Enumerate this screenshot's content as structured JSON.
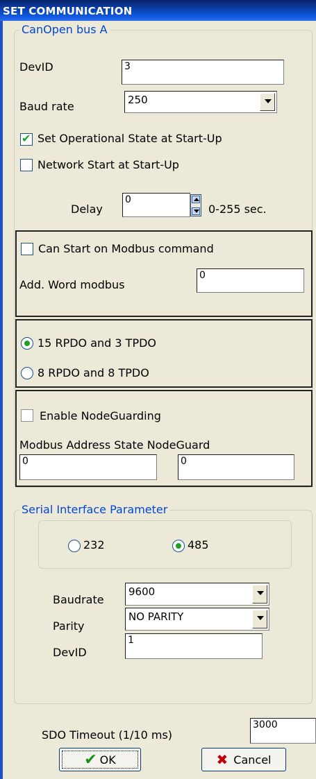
{
  "window": {
    "title": "SET COMMUNICATION"
  },
  "canopen": {
    "legend": "CanOpen bus  A",
    "devid_label": "DevID",
    "devid_value": "3",
    "baud_label": "Baud rate",
    "baud_value": "250",
    "set_operational_label": "Set Operational State at Start-Up",
    "set_operational_checked": true,
    "network_start_label": "Network Start at Start-Up",
    "network_start_checked": false,
    "delay_label": "Delay",
    "delay_value": "0",
    "delay_range": "0-255 sec.",
    "can_start_label": "Can Start on Modbus command",
    "can_start_checked": false,
    "add_word_label": "Add. Word modbus",
    "add_word_value": "0",
    "pdo_option1": "15 RPDO and 3 TPDO",
    "pdo_option2": "8 RPDO and 8 TPDO",
    "pdo_selected": "15 RPDO and 3 TPDO",
    "enable_nodeguard_label": "Enable NodeGuarding",
    "enable_nodeguard_checked": false,
    "modbus_address_state_label": "Modbus Address State NodeGuard",
    "nodeguard_value1": "0",
    "nodeguard_value2": "0"
  },
  "serial": {
    "legend": "Serial Interface Parameter",
    "option_232": "232",
    "option_485": "485",
    "selected": "485",
    "baudrate_label": "Baudrate",
    "baudrate_value": "9600",
    "parity_label": "Parity",
    "parity_value": "NO PARITY",
    "devid_label": "DevID",
    "devid_value": "1"
  },
  "sdo": {
    "label": "SDO Timeout (1/10 ms)",
    "value": "3000"
  },
  "buttons": {
    "ok": "OK",
    "cancel": "Cancel"
  },
  "colors": {
    "title_bar": "#0a3fb0",
    "legend_text": "#0046d5",
    "dialog_bg": "#ece9d8",
    "check_green": "#21a121",
    "cancel_x": "#c00000"
  }
}
